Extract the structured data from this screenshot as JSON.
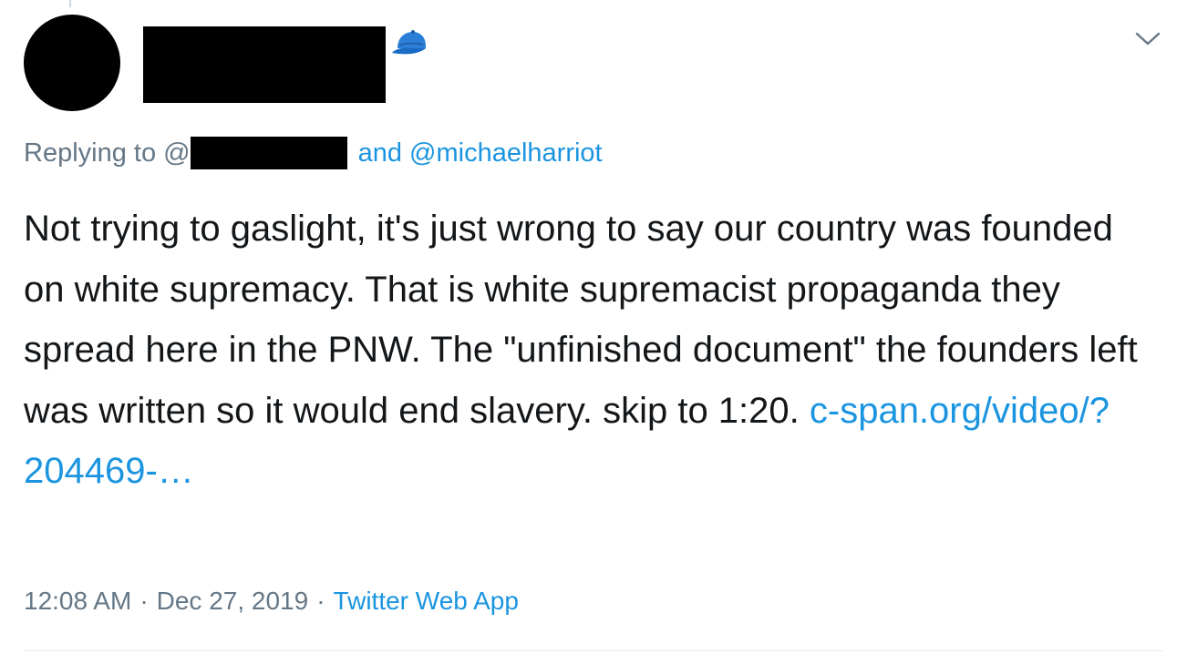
{
  "tweet": {
    "reply": {
      "prefix": "Replying to @",
      "mention": "and @michaelharriot"
    },
    "body": {
      "text": "Not trying to gaslight, it's just wrong to say our country was founded on white supremacy. That is white supremacist propaganda they spread here in the PNW. The \"unfinished document\" the founders left was written so it would end slavery. skip to 1:20. ",
      "link": "c-span.org/video/?204469-…"
    },
    "meta": {
      "time": "12:08 AM",
      "separator": "·",
      "date": "Dec 27, 2019",
      "source": "Twitter Web App"
    },
    "icons": {
      "cap": "baseball-cap-icon",
      "menu": "chevron-down-icon"
    },
    "colors": {
      "link": "#1b95e0",
      "secondary_text": "#657786",
      "primary_text": "#14171a",
      "redaction": "#000000"
    }
  }
}
